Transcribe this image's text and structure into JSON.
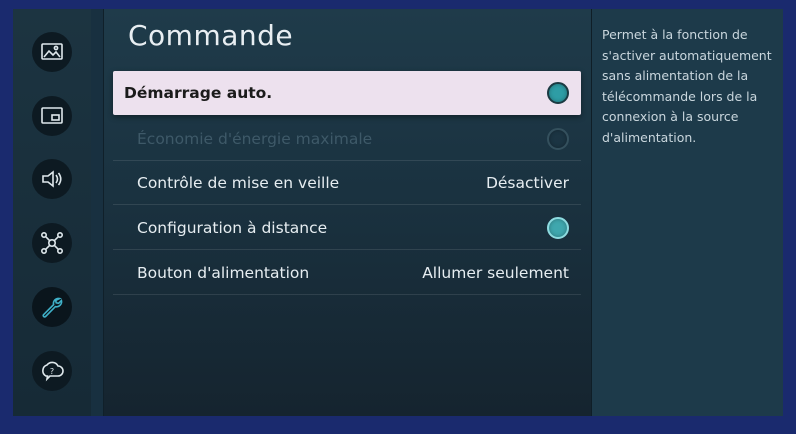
{
  "page": {
    "title": "Commande"
  },
  "sidebar": {
    "items": [
      {
        "icon": "picture-icon"
      },
      {
        "icon": "screen-size-icon"
      },
      {
        "icon": "sound-icon"
      },
      {
        "icon": "network-icon"
      },
      {
        "icon": "wrench-icon",
        "active": true
      },
      {
        "icon": "support-icon"
      }
    ]
  },
  "settings": {
    "items": [
      {
        "label": "Démarrage auto.",
        "control": "toggle",
        "state": "on",
        "selected": true
      },
      {
        "label": "Économie d'énergie maximale",
        "control": "toggle",
        "state": "off",
        "disabled": true
      },
      {
        "label": "Contrôle de mise en veille",
        "value": "Désactiver"
      },
      {
        "label": "Configuration à distance",
        "control": "toggle",
        "state": "on"
      },
      {
        "label": "Bouton d'alimentation",
        "value": "Allumer seulement"
      }
    ]
  },
  "help": {
    "text": "Permet à la fonction de s'activer automatiquement sans alimentation de la télécommande lors de la connexion à la source d'alimentation."
  },
  "colors": {
    "toggle_on": "#3fa7ae",
    "selection": "#ede1ee",
    "frame": "#1a2a6e"
  }
}
